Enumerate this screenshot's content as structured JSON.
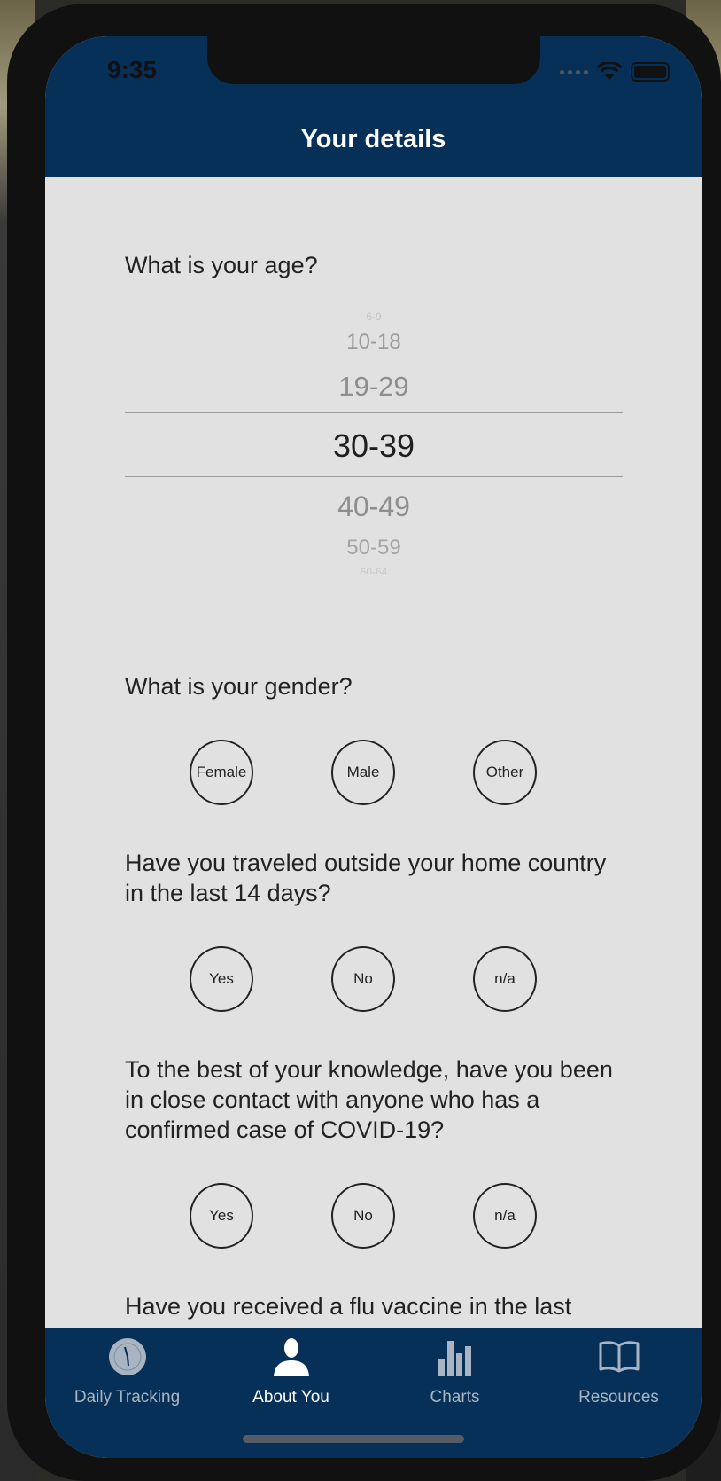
{
  "status_bar": {
    "time": "9:35"
  },
  "header": {
    "title": "Your details"
  },
  "questions": {
    "age": {
      "text": "What is your age?",
      "options_visible": [
        "6-9",
        "10-18",
        "19-29",
        "30-39",
        "40-49",
        "50-59",
        "60-64"
      ],
      "selected": "30-39"
    },
    "gender": {
      "text": "What is your gender?",
      "options": [
        "Female",
        "Male",
        "Other"
      ]
    },
    "travel": {
      "text": "Have you traveled outside your home country in the last 14 days?",
      "options": [
        "Yes",
        "No",
        "n/a"
      ]
    },
    "contact": {
      "text": "To the best of your knowledge, have you been in close contact with anyone who has a confirmed case of COVID-19?",
      "options": [
        "Yes",
        "No",
        "n/a"
      ]
    },
    "flu": {
      "text": "Have you received a flu vaccine in the last"
    }
  },
  "tabs": [
    {
      "label": "Daily Tracking",
      "icon": "clock-icon"
    },
    {
      "label": "About You",
      "icon": "person-icon",
      "active": true
    },
    {
      "label": "Charts",
      "icon": "bar-chart-icon"
    },
    {
      "label": "Resources",
      "icon": "book-icon"
    }
  ],
  "colors": {
    "header_bg": "#063057",
    "content_bg": "#e1e1e1",
    "tab_inactive": "#a9b4c2",
    "tab_active": "#ffffff"
  }
}
